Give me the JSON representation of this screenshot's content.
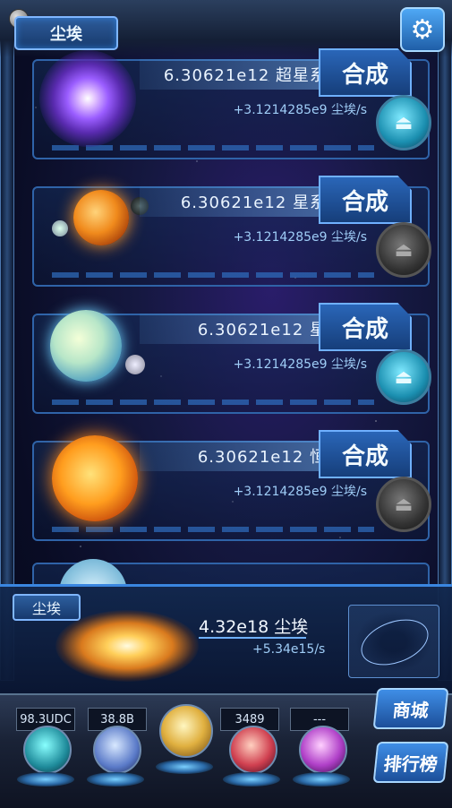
{
  "header": {
    "title": "尘埃",
    "settings_icon": "gear-icon"
  },
  "items": [
    {
      "amount_name": "6.30621e12 超星系团",
      "merge_label": "合成",
      "rate": "+3.1214285e9 尘埃/s",
      "upgrade_enabled": true
    },
    {
      "amount_name": "6.30621e12 星系团",
      "merge_label": "合成",
      "rate": "+3.1214285e9 尘埃/s",
      "upgrade_enabled": false
    },
    {
      "amount_name": "6.30621e12 星系",
      "merge_label": "合成",
      "rate": "+3.1214285e9 尘埃/s",
      "upgrade_enabled": true
    },
    {
      "amount_name": "6.30621e12 恒星",
      "merge_label": "合成",
      "rate": "+3.1214285e9 尘埃/s",
      "upgrade_enabled": false
    }
  ],
  "dust_panel": {
    "label": "尘埃",
    "total": "4.32e18 尘埃",
    "rate": "+5.34e15/s"
  },
  "bottom_stats": [
    "98.3UDC",
    "38.8B",
    "",
    "3489",
    "---"
  ],
  "side_buttons": {
    "shop": "商城",
    "ranking": "排行榜"
  },
  "colors": {
    "accent": "#3a86e0",
    "button": "#2a66b8"
  }
}
